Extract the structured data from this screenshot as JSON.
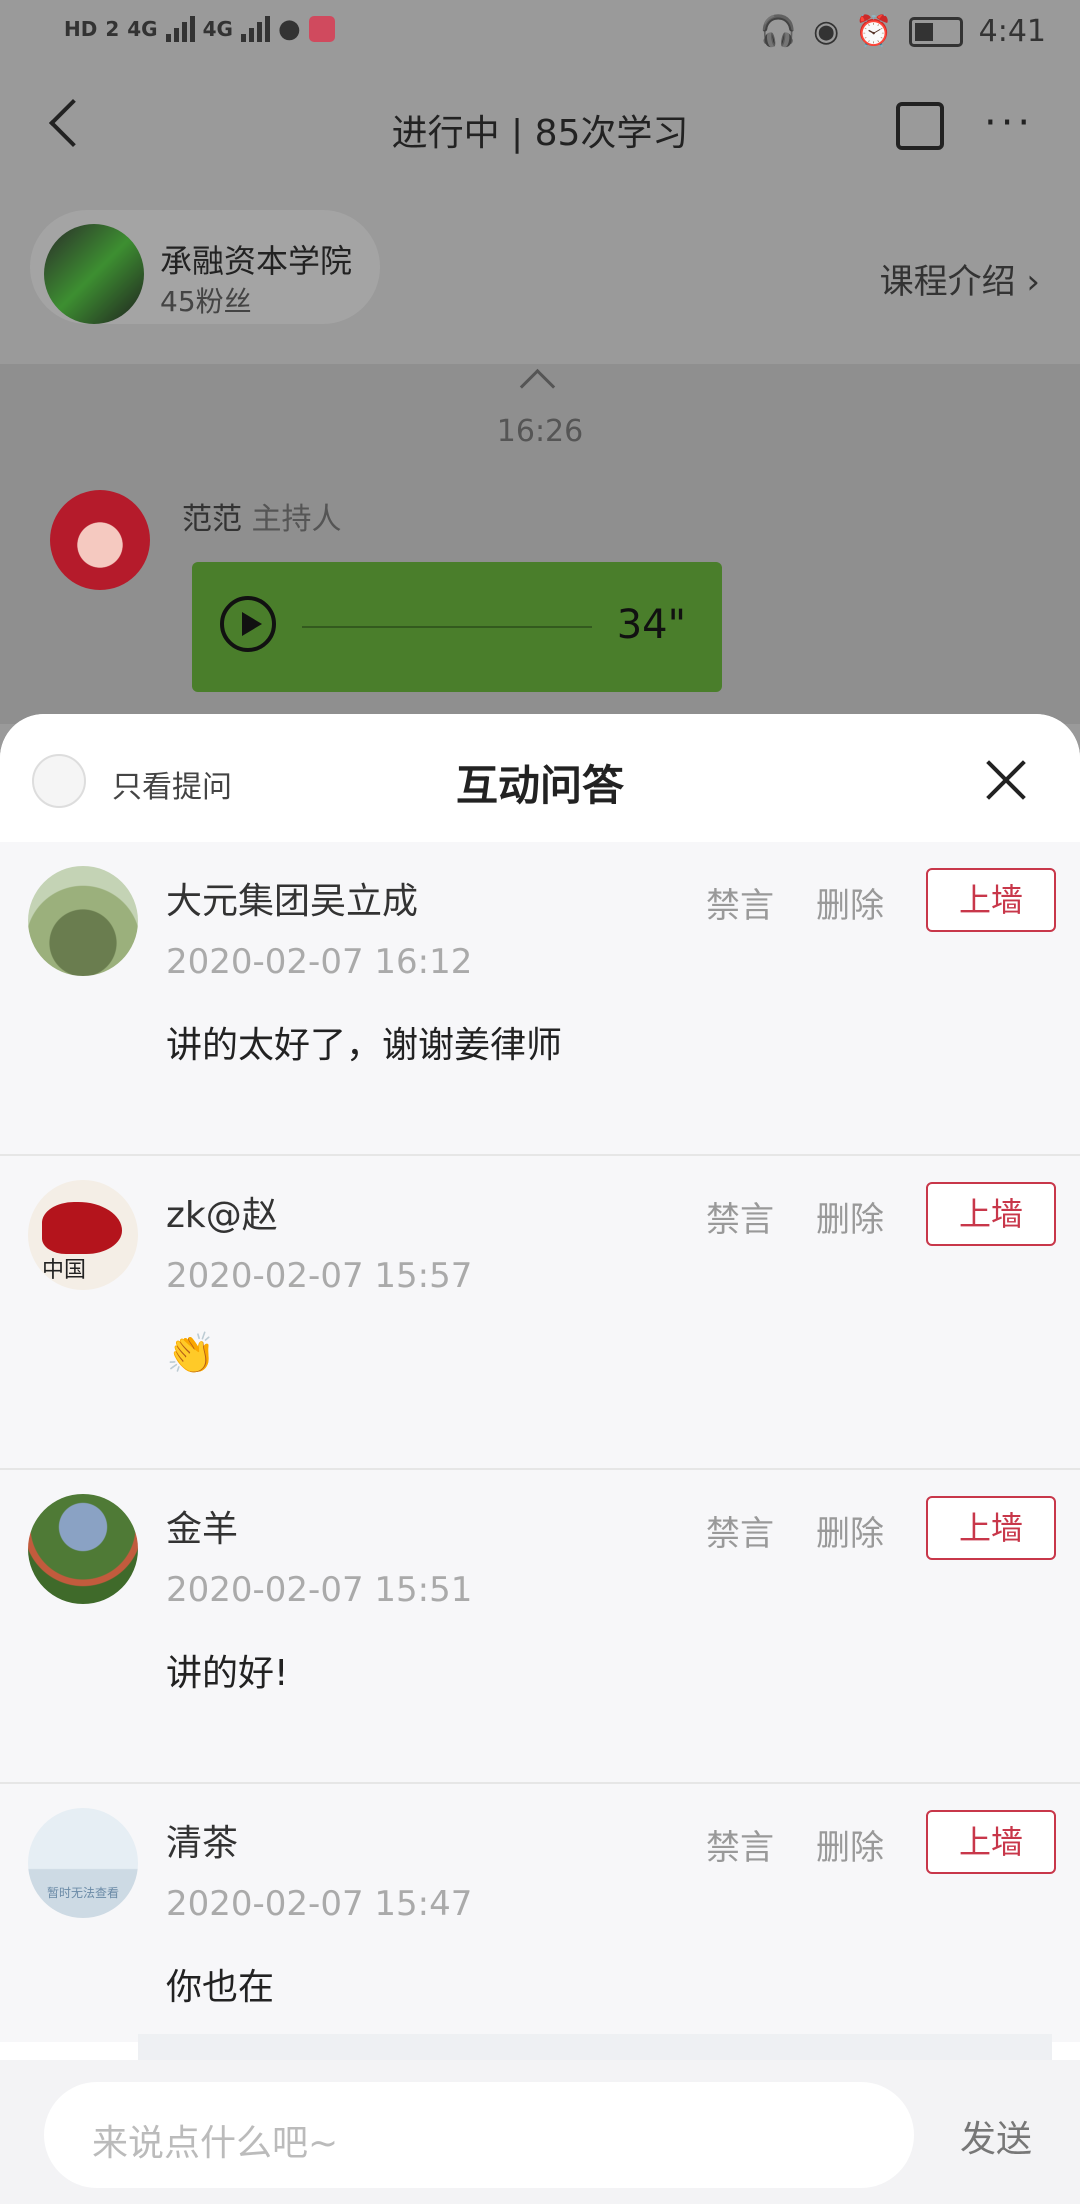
{
  "status_bar": {
    "hd": "HD",
    "hd_sub": "2",
    "net1": "4G",
    "net2": "4G",
    "time": "4:41"
  },
  "nav": {
    "title": "进行中 | 85次学习",
    "more": "···"
  },
  "host": {
    "name": "承融资本学院",
    "fans": "45粉丝",
    "course_intro": "课程介绍 ›"
  },
  "chat": {
    "timestamp": "16:26",
    "speaker_name": "范范",
    "speaker_role": "主持人",
    "voice_duration": "34\""
  },
  "sheet": {
    "filter_label": "只看提问",
    "title": "互动问答",
    "actions": {
      "mute": "禁言",
      "delete": "删除",
      "wall": "上墙"
    },
    "items": [
      {
        "name": "大元集团吴立成",
        "time": "2020-02-07 16:12",
        "text": "讲的太好了，谢谢姜律师"
      },
      {
        "name": "zk@赵",
        "time": "2020-02-07 15:57",
        "text": "👏",
        "avatar_text": "中国"
      },
      {
        "name": "金羊",
        "time": "2020-02-07 15:51",
        "text": "讲的好!"
      },
      {
        "name": "清茶",
        "time": "2020-02-07 15:47",
        "text": "你也在",
        "avatar_text": "暂时无法查看"
      }
    ]
  },
  "input": {
    "placeholder": "来说点什么吧~",
    "send_label": "发送"
  },
  "colors": {
    "accent": "#c8374a",
    "voice_bubble": "#6fc23f"
  }
}
